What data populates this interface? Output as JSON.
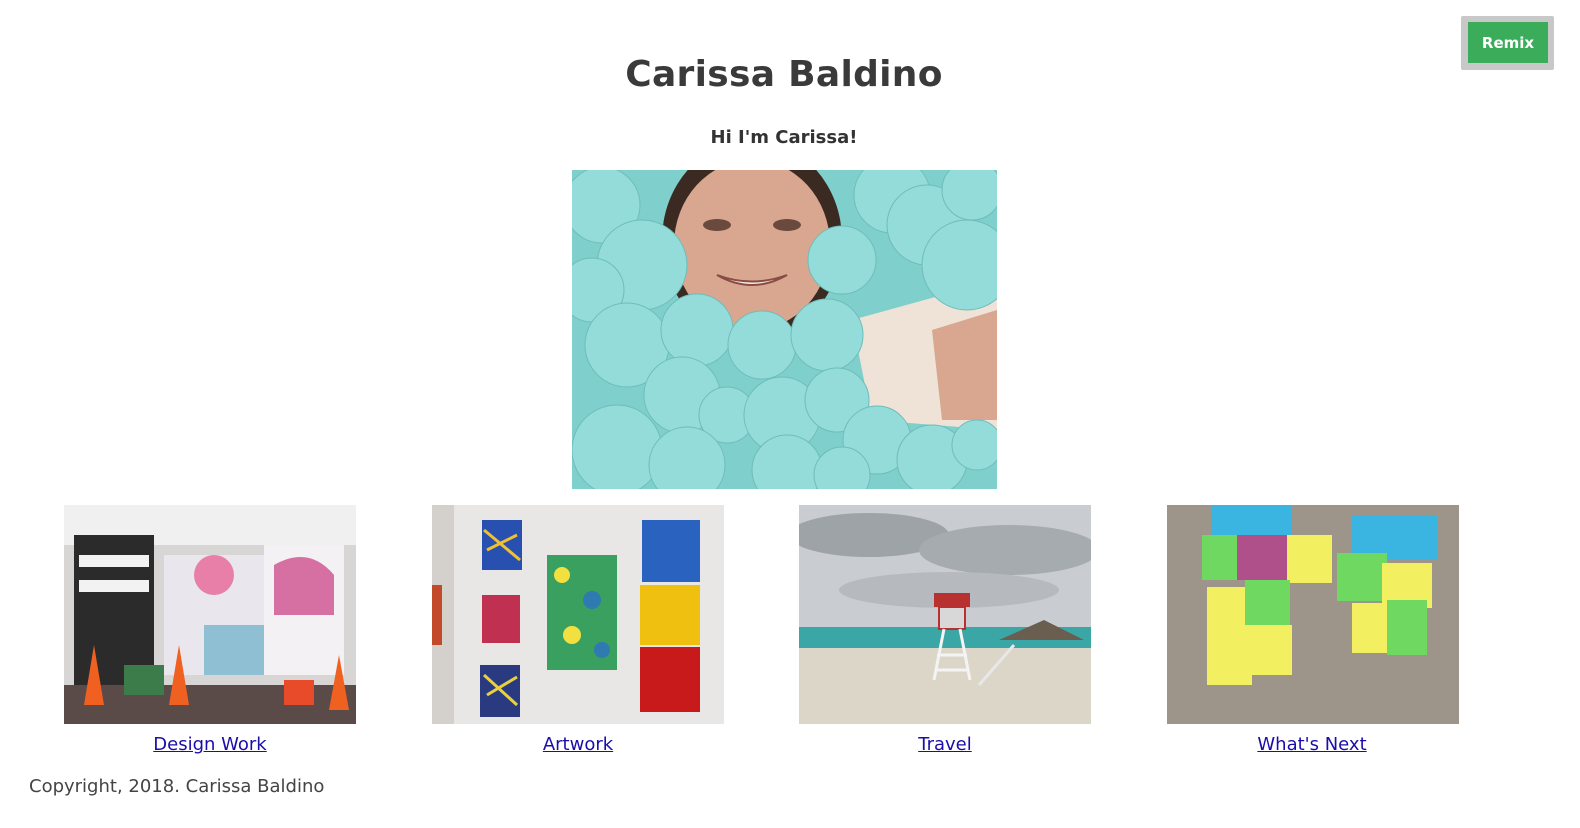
{
  "remix": {
    "label": "Remix"
  },
  "header": {
    "title": "Carissa Baldino",
    "intro": "Hi I'm Carissa!"
  },
  "gallery": [
    {
      "label": "Design Work"
    },
    {
      "label": "Artwork"
    },
    {
      "label": "Travel"
    },
    {
      "label": "What's Next"
    }
  ],
  "footer": {
    "copyright": "Copyright, 2018. Carissa Baldino"
  },
  "colors": {
    "remix_green": "#3aac5a",
    "link_blue": "#1a0dab",
    "ball_teal": "#8fd8d6"
  }
}
